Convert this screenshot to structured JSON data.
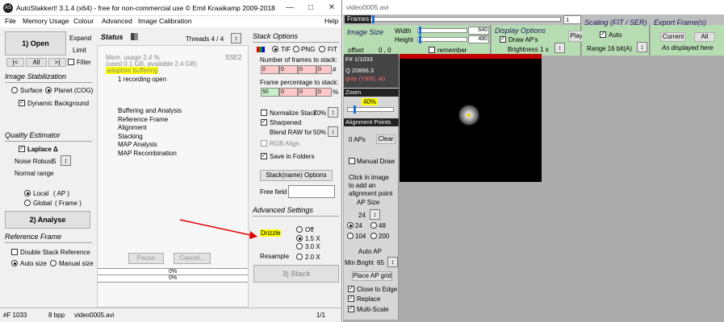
{
  "astitle": "AutoStakkert! 3.1.4 (x64) - free for non-commercial use © Emil Kraaikamp 2009-2018",
  "menu": {
    "file": "File",
    "memory": "Memory Usage",
    "colour": "Colour",
    "advanced": "Advanced",
    "calib": "Image Calibration",
    "help": "Help"
  },
  "open": {
    "label": "1) Open",
    "expand": "Expand",
    "limit": "Limit",
    "nav_prev": "|<",
    "nav_all": "All",
    "nav_next": ">|",
    "filter": "Filter"
  },
  "stab": {
    "title": "Image Stabilization",
    "surface": "Surface",
    "planet": "Planet (COG)",
    "dynbg": "Dynamic Background"
  },
  "qe": {
    "title": "Quality Estimator",
    "laplace": "Laplace Δ",
    "noise": "Noise Robust",
    "noise_val": "5",
    "normal": "Normal range",
    "local": "Local",
    "local_ap": "( AP )",
    "global": "Global",
    "global_fr": "( Frame )"
  },
  "analyse": "2) Analyse",
  "ref": {
    "title": "Reference Frame",
    "double": "Double Stack Reference",
    "auto": "Auto size",
    "manual": "Manual size"
  },
  "status": {
    "title": "Status",
    "threads": "Threads 4 / 4",
    "sse": "SSE2",
    "mem1": "Mem. usage 2.4 %",
    "mem2": "(used 0.1 GB, available 2.4 GB)",
    "adaptive": "adaptive buffering",
    "recording": "1 recording open",
    "steps": [
      "Buffering and Analysis",
      "Reference Frame",
      "Alignment",
      "Stacking",
      "MAP Analysis",
      "MAP Recombination"
    ],
    "pause": "Pause",
    "cancel": "Cancel...",
    "p1": "0%",
    "p2": "0%"
  },
  "stack": {
    "title": "Stack Options",
    "tif": "TIF",
    "png": "PNG",
    "fit": "FIT",
    "nframes": "Number of frames to stack:",
    "frames": [
      "0",
      "0",
      "0",
      "0"
    ],
    "hash": "#",
    "pct": "Frame percentage to stack:",
    "pcts": [
      "50",
      "0",
      "0",
      "0"
    ],
    "pctsign": "%",
    "normalize": "Normalize Stack",
    "normalize_val": "70%",
    "sharpened": "Sharpened",
    "blend": "Blend RAW for",
    "blend_val": "50%",
    "rgb": "RGB Align",
    "save": "Save in Folders",
    "stackname": "Stack(name) Options",
    "freefield": "Free field"
  },
  "adv": {
    "title": "Advanced Settings",
    "drizzle": "Drizzle",
    "off": "Off",
    "x15": "1.5 X",
    "x30": "3.0 X",
    "resample": "Resample",
    "x20": "2.0 X",
    "stackbtn": "3) Stack"
  },
  "footer": {
    "frames": "#F 1033",
    "bpp": "8 bpp",
    "file": "video0005.avi",
    "page": "1/1"
  },
  "viewer": {
    "title": "video0005.avi",
    "frames_label": "Frames",
    "frame_num": "1",
    "imgsize": "Image Size",
    "width_l": "Width",
    "width_v": "640",
    "height_l": "Height",
    "height_v": "480",
    "offset": "offset",
    "offset_v": "0 , 0",
    "remember": "remember",
    "disp": "Display Options",
    "drawap": "Draw AP's",
    "bright": "Brightness 1 x",
    "play": "Play",
    "scaling": "Scaling (FIT / SER)",
    "auto": "Auto",
    "range": "Range 16 bit(A)",
    "export": "Export Frame(s)",
    "current": "Current",
    "all": "All",
    "asdisp": "As displayed here",
    "finfo1": "F# 1/1033",
    "finfo2": "Q  20896.3",
    "finfo3": "gray (Y800, ai)",
    "zoom": "Zoom",
    "zoom_v": "40%",
    "ap": "Alignment Points",
    "aps": "0 APs",
    "clear": "Clear",
    "manual": "Manual Draw",
    "click": [
      "Click in image",
      "to add an",
      "alignment point"
    ],
    "apsize": "AP Size",
    "ap24": "24",
    "r24": "24",
    "r48": "48",
    "r104": "104",
    "r200": "200",
    "autoap": "Auto AP",
    "minbright": "Min Bright",
    "minbright_v": "65",
    "grid": "Place AP grid",
    "close": "Close to Edge",
    "replace": "Replace",
    "multi": "Multi-Scale"
  }
}
